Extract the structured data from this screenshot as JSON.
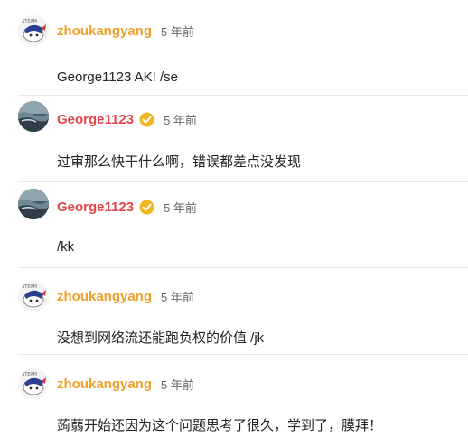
{
  "comments": [
    {
      "username": "zhoukangyang",
      "name_color": "orange",
      "verified": false,
      "avatar": "anime-character-avatar",
      "time": "5 年前",
      "content": "George1123 AK! /se"
    },
    {
      "username": "George1123",
      "name_color": "red",
      "verified": true,
      "avatar": "ocean-wave-avatar",
      "time": "5 年前",
      "content": "过审那么快干什么啊，错误都差点没发现"
    },
    {
      "username": "George1123",
      "name_color": "red",
      "verified": true,
      "avatar": "ocean-wave-avatar",
      "time": "5 年前",
      "content": "/kk"
    },
    {
      "username": "zhoukangyang",
      "name_color": "orange",
      "verified": false,
      "avatar": "anime-character-avatar",
      "time": "5 年前",
      "content": "没想到网络流还能跑负权的价值 /jk"
    },
    {
      "username": "zhoukangyang",
      "name_color": "orange",
      "verified": false,
      "avatar": "anime-character-avatar",
      "time": "5 年前",
      "content": "蒟蒻开始还因为这个问题思考了很久，学到了，膜拜！"
    }
  ],
  "colors": {
    "orange": "#f1a02b",
    "red": "#e5464b",
    "verified_badge": "#f1b521"
  }
}
